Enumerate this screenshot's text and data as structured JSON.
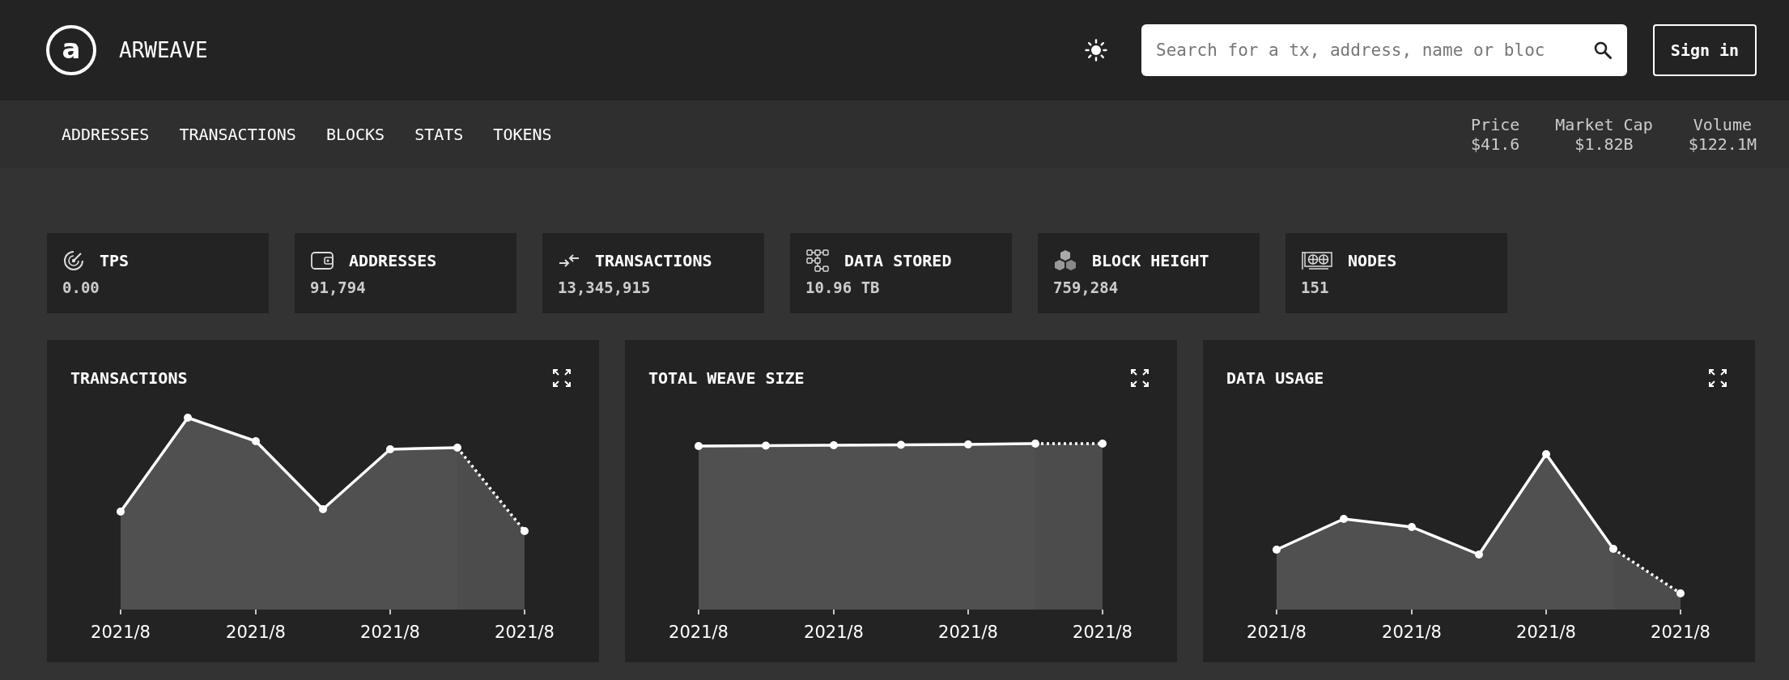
{
  "header": {
    "logo_letter": "a",
    "title": "ARWEAVE",
    "search": {
      "placeholder": "Search for a tx, address, name or bloc"
    },
    "sign_in": "Sign in"
  },
  "nav": {
    "items": [
      "ADDRESSES",
      "TRANSACTIONS",
      "BLOCKS",
      "STATS",
      "TOKENS"
    ],
    "market": [
      {
        "label": "Price",
        "value": "$41.6"
      },
      {
        "label": "Market Cap",
        "value": "$1.82B"
      },
      {
        "label": "Volume",
        "value": "$122.1M"
      }
    ]
  },
  "stats": [
    {
      "kind": "speed",
      "label": "TPS",
      "value": "0.00"
    },
    {
      "kind": "wallet",
      "label": "ADDRESSES",
      "value": "91,794"
    },
    {
      "kind": "transfer",
      "label": "TRANSACTIONS",
      "value": "13,345,915"
    },
    {
      "kind": "storage",
      "label": "DATA STORED",
      "value": "10.96 TB"
    },
    {
      "kind": "blocks",
      "label": "BLOCK HEIGHT",
      "value": "759,284"
    },
    {
      "kind": "nodes",
      "label": "NODES",
      "value": "151"
    }
  ],
  "charts": [
    {
      "title": "TRANSACTIONS",
      "x_labels": [
        "2021/8",
        "2021/8",
        "2021/8",
        "2021/8"
      ]
    },
    {
      "title": "TOTAL WEAVE SIZE",
      "x_labels": [
        "2021/8",
        "2021/8",
        "2021/8",
        "2021/8"
      ]
    },
    {
      "title": "DATA USAGE",
      "x_labels": [
        "2021/8",
        "2021/8",
        "2021/8",
        "2021/8"
      ]
    }
  ]
}
